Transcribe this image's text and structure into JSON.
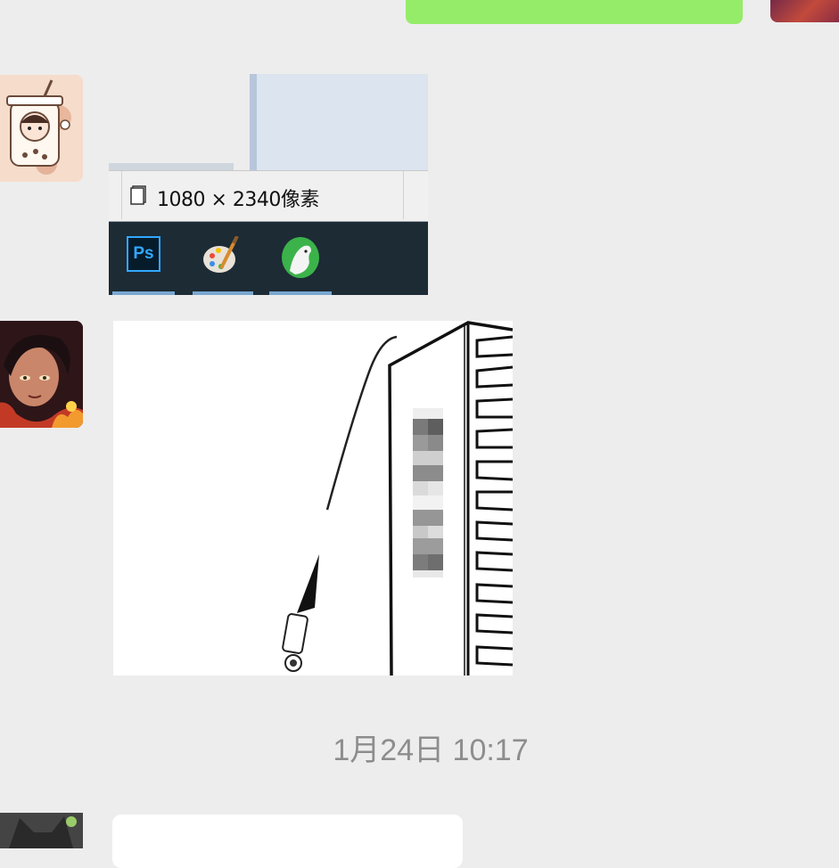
{
  "screenshot_message": {
    "dimensions_text": "1080 × 2340像素",
    "taskbar_icons": [
      {
        "icon": "photoshop-icon",
        "label": "Ps"
      },
      {
        "icon": "paint-palette-icon"
      },
      {
        "icon": "green-bird-app-icon"
      }
    ]
  },
  "timestamp": "1月24日 10:17",
  "colors": {
    "outgoing_bubble": "#95ec69",
    "chat_background": "#ededed",
    "timestamp_text": "#8d8d8d"
  }
}
